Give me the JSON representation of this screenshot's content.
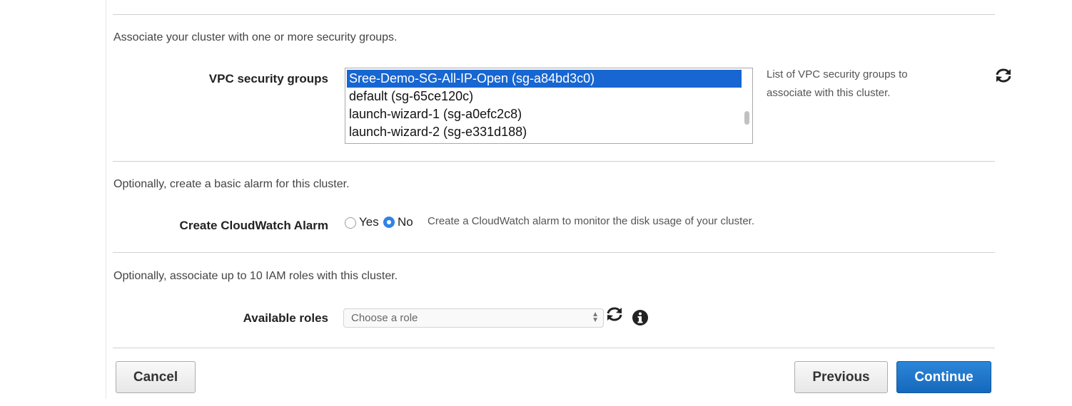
{
  "security": {
    "description": "Associate your cluster with one or more security groups.",
    "label": "VPC security groups",
    "options": [
      "Sree-Demo-SG-All-IP-Open (sg-a84bd3c0)",
      "default (sg-65ce120c)",
      "launch-wizard-1 (sg-a0efc2c8)",
      "launch-wizard-2 (sg-e331d188)"
    ],
    "selected": "Sree-Demo-SG-All-IP-Open (sg-a84bd3c0)",
    "help_line1": "List of VPC security groups to",
    "help_line2": "associate with this cluster.",
    "refresh_icon": "refresh-icon"
  },
  "alarm": {
    "description": "Optionally, create a basic alarm for this cluster.",
    "label": "Create CloudWatch Alarm",
    "yes_label": "Yes",
    "no_label": "No",
    "selected": "No",
    "help": "Create a CloudWatch alarm to monitor the disk usage of your cluster."
  },
  "iam": {
    "description": "Optionally, associate up to 10 IAM roles with this cluster.",
    "label": "Available roles",
    "placeholder": "Choose a role",
    "refresh_icon": "refresh-icon",
    "info_icon": "info-icon"
  },
  "footer": {
    "cancel_label": "Cancel",
    "previous_label": "Previous",
    "continue_label": "Continue"
  },
  "colors": {
    "selection": "#1766d1",
    "primary_button": "#1a73c9",
    "radio_checked": "#2f83e6"
  }
}
